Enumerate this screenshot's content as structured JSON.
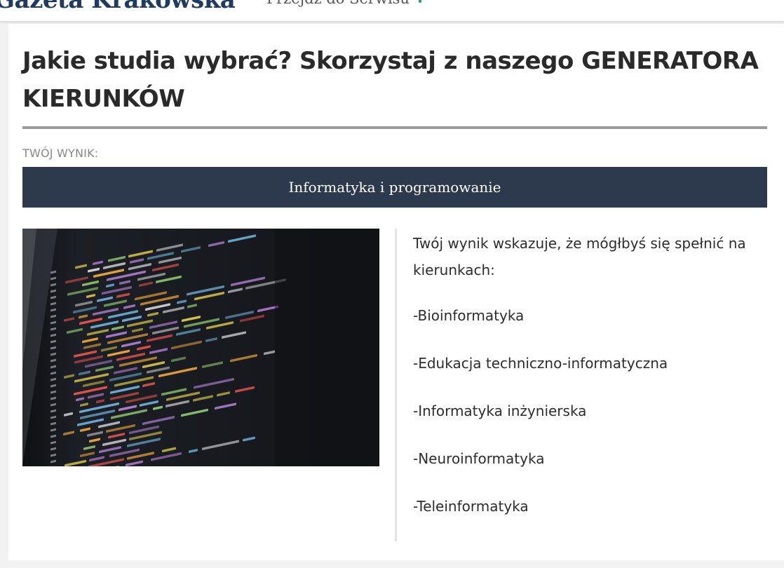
{
  "header": {
    "logo_text": "Gazeta Krakowska",
    "goto_label": "Przejdź do Serwisu"
  },
  "article": {
    "title": "Jakie studia wybrać? Skorzystaj z naszego GENERATORA KIERUNKÓW",
    "result_label": "TWÓJ WYNIK:",
    "result_value": "Informatyka i programowanie",
    "image_subject": "code on a monitor screen",
    "intro": "Twój wynik wskazuje, że mógłbyś się spełnić na kierunkach:",
    "courses": [
      "-Bioinformatyka",
      "-Edukacja techniczno-informatyczna",
      "-Informatyka inżynierska",
      "-Neuroinformatyka",
      "-Teleinformatyka"
    ]
  },
  "colors": {
    "result_bg": "#2d3a4d",
    "logo": "#1f3b60",
    "rule": "#9b9b9b",
    "accent_dot": "#2e9e6a"
  }
}
